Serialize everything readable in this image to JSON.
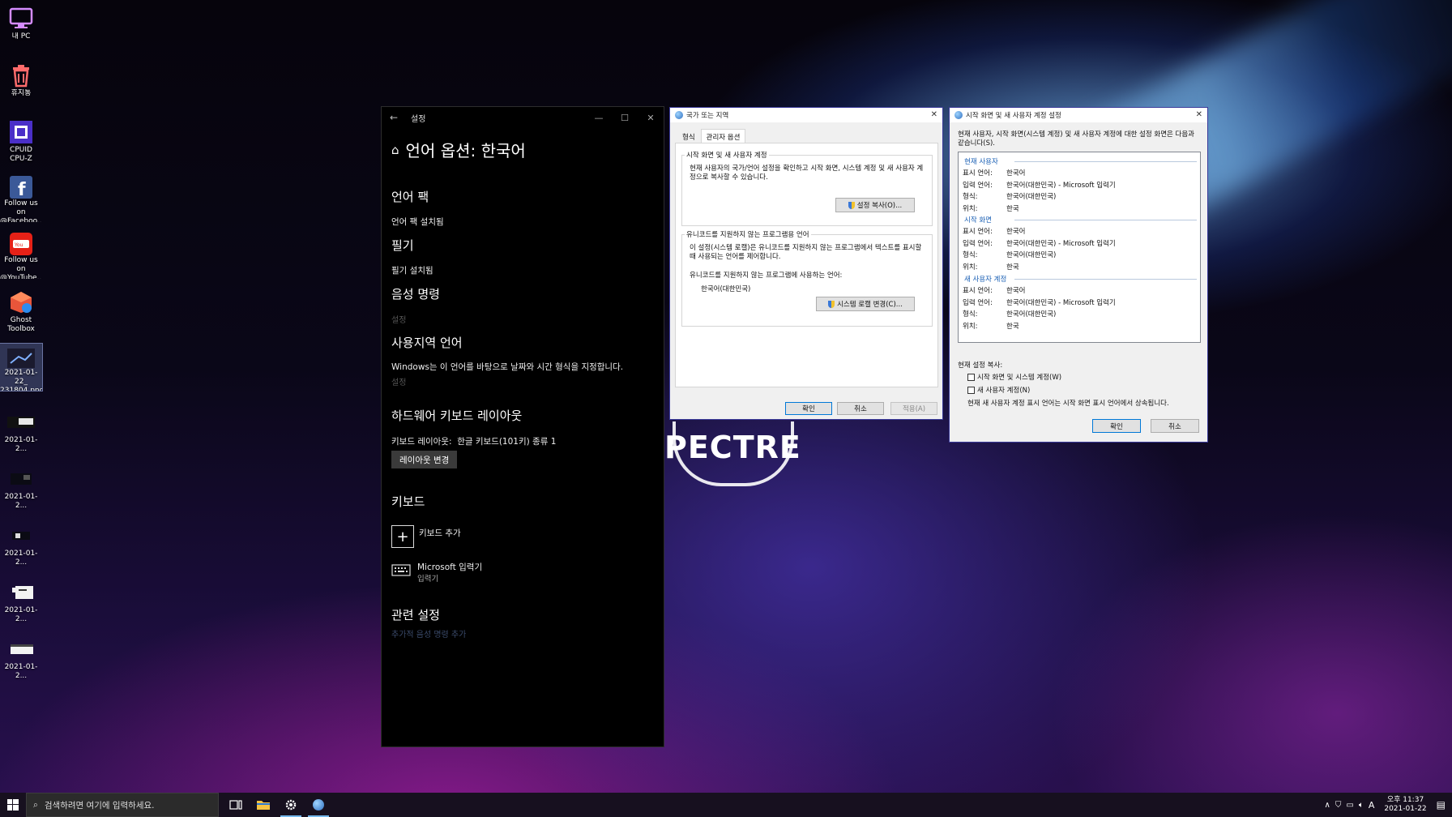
{
  "desktop": {
    "icons": [
      {
        "label": "내 PC",
        "icon": "monitor-icon"
      },
      {
        "label": "휴지통",
        "icon": "recycle-bin-icon"
      },
      {
        "label": "CPUID\nCPU-Z",
        "icon": "cpu-z-icon"
      },
      {
        "label": "Follow us on\n@Faceboo...",
        "icon": "facebook-icon"
      },
      {
        "label": "Follow us on\n@YouTube...",
        "icon": "youtube-icon"
      },
      {
        "label": "Ghost\nToolbox",
        "icon": "ghost-toolbox-icon"
      },
      {
        "label": "2021-01-22_\n231804.png",
        "icon": "image-file-icon"
      },
      {
        "label": "2021-01-2...",
        "icon": "image-file-icon"
      },
      {
        "label": "2021-01-2...",
        "icon": "image-file-icon"
      },
      {
        "label": "2021-01-2...",
        "icon": "image-file-icon"
      },
      {
        "label": "2021-01-2...",
        "icon": "image-file-icon"
      },
      {
        "label": "2021-01-2...",
        "icon": "image-file-icon"
      }
    ],
    "wallpaper_text": "PECTRE"
  },
  "settings": {
    "window_title": "설정",
    "page_title": "언어 옵션: 한국어",
    "language_pack_heading": "언어 팩",
    "language_pack_status": "언어 팩 설치됨",
    "handwriting_heading": "필기",
    "handwriting_status": "필기 설치됨",
    "speech_heading": "음성 명령",
    "speech_link": "설정",
    "region_heading": "사용지역 언어",
    "region_desc": "Windows는 이 언어를 바탕으로 날짜와 시간 형식을 지정합니다.",
    "region_link": "설정",
    "hw_keyboard_heading": "하드웨어 키보드 레이아웃",
    "keyboard_layout_label": "키보드 레이아웃:",
    "keyboard_layout_value": "한글 키보드(101키) 종류 1",
    "change_layout_button": "레이아웃 변경",
    "keyboards_heading": "키보드",
    "add_keyboard": "키보드 추가",
    "ime_name": "Microsoft 입력기",
    "ime_sub": "입력기",
    "related_heading": "관련 설정",
    "related_link": "추가적 음성 명령 추가"
  },
  "region_dialog": {
    "title": "국가 또는 지역",
    "tabs": [
      "형식",
      "관리자 옵션"
    ],
    "group1_label": "시작 화면 및 새 사용자 계정",
    "group1_text": "현재 사용자의 국가/언어 설정을 확인하고 시작 화면, 시스템 계정 및 새 사용자 계정으로 복사할 수 있습니다.",
    "copy_button": "설정 복사(O)...",
    "group2_label": "유니코드를 지원하지 않는 프로그램용 언어",
    "group2_text": "이 설정(시스템 로캘)은 유니코드를 지원하지 않는 프로그램에서 텍스트를 표시할 때 사용되는 언어를 제어합니다.",
    "current_lang_label": "유니코드를 지원하지 않는 프로그램에 사용하는 언어:",
    "current_lang_value": "한국어(대한민국)",
    "change_locale_button": "시스템 로캘 변경(C)...",
    "ok": "확인",
    "cancel": "취소",
    "apply": "적용(A)"
  },
  "copy_dialog": {
    "title": "시작 화면 및 새 사용자 계정 설정",
    "intro": "현재 사용자, 시작 화면(시스템 계정) 및 새 사용자 계정에 대한 설정 화면은 다음과 같습니다(S).",
    "sections": [
      {
        "heading": "현재 사용자",
        "rows": [
          {
            "k": "표시 언어:",
            "v": "한국어"
          },
          {
            "k": "입력 언어:",
            "v": "한국어(대한민국) - Microsoft 입력기"
          },
          {
            "k": "형식:",
            "v": "한국어(대한민국)"
          },
          {
            "k": "위치:",
            "v": "한국"
          }
        ]
      },
      {
        "heading": "시작 화면",
        "rows": [
          {
            "k": "표시 언어:",
            "v": "한국어"
          },
          {
            "k": "입력 언어:",
            "v": "한국어(대한민국) - Microsoft 입력기"
          },
          {
            "k": "형식:",
            "v": "한국어(대한민국)"
          },
          {
            "k": "위치:",
            "v": "한국"
          }
        ]
      },
      {
        "heading": "새 사용자 계정",
        "rows": [
          {
            "k": "표시 언어:",
            "v": "한국어"
          },
          {
            "k": "입력 언어:",
            "v": "한국어(대한민국) - Microsoft 입력기"
          },
          {
            "k": "형식:",
            "v": "한국어(대한민국)"
          },
          {
            "k": "위치:",
            "v": "한국"
          }
        ]
      }
    ],
    "copy_label": "현재 설정 복사:",
    "checkbox1": "시작 화면 및 시스템 계정(W)",
    "checkbox2": "새 사용자 계정(N)",
    "note": "현재 새 사용자 계정 표시 언어는 시작 화면 표시 언어에서 상속됩니다.",
    "ok": "확인",
    "cancel": "취소"
  },
  "taskbar": {
    "search_placeholder": "검색하려면 여기에 입력하세요.",
    "ime_indicator": "A",
    "time": "오후 11:37",
    "date": "2021-01-22"
  },
  "colors": {
    "accent": "#0078d7",
    "link_blue": "#1a5fb4",
    "settings_bg": "#000000"
  }
}
